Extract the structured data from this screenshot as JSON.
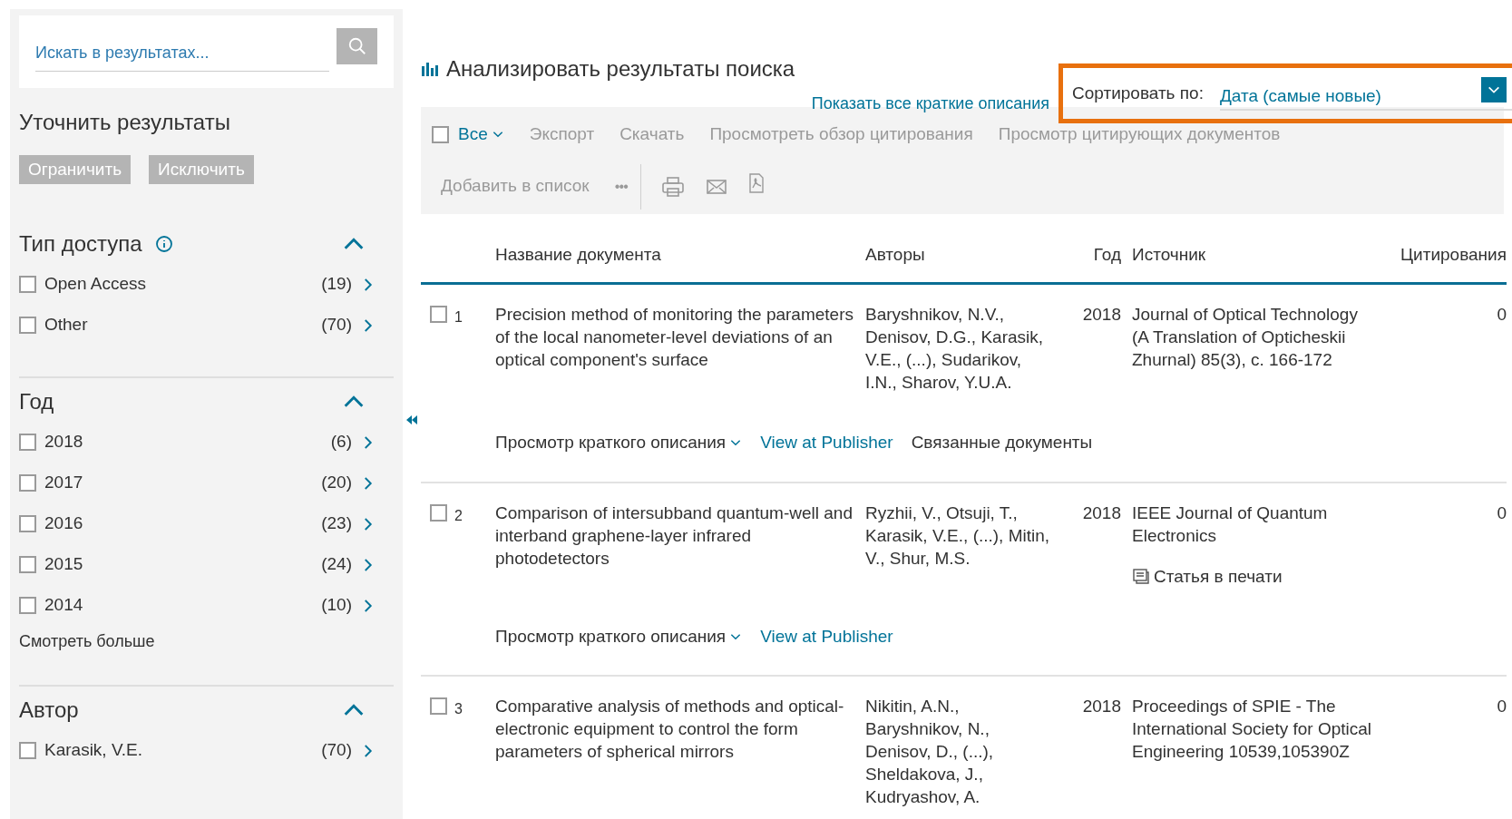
{
  "sidebar": {
    "search": {
      "placeholder": "Искать в результатах..."
    },
    "refine_title": "Уточнить результаты",
    "buttons": [
      "Ограничить",
      "Исключить"
    ],
    "sections": [
      {
        "title": "Тип доступа",
        "info": true,
        "expanded": true,
        "items": [
          {
            "label": "Open Access",
            "count": "(19)",
            "checked": false
          },
          {
            "label": "Other",
            "count": "(70)",
            "checked": false
          }
        ]
      },
      {
        "title": "Год",
        "info": false,
        "expanded": true,
        "more": "Смотреть больше",
        "items": [
          {
            "label": "2018",
            "count": "(6)",
            "checked": false
          },
          {
            "label": "2017",
            "count": "(20)",
            "checked": false
          },
          {
            "label": "2016",
            "count": "(23)",
            "checked": false
          },
          {
            "label": "2015",
            "count": "(24)",
            "checked": false
          },
          {
            "label": "2014",
            "count": "(10)",
            "checked": false
          }
        ]
      },
      {
        "title": "Автор",
        "info": false,
        "expanded": true,
        "items": [
          {
            "label": "Karasik, V.E.",
            "count": "(70)",
            "checked": false
          }
        ]
      }
    ]
  },
  "main": {
    "title": "Анализировать результаты поиска",
    "show_all_link": "Показать все краткие описания",
    "sort": {
      "label": "Сортировать по:",
      "value": "Дата (самые новые)"
    },
    "toolbar": {
      "select_all": {
        "label": "Все",
        "checked": false
      },
      "actions": [
        "Экспорт",
        "Скачать",
        "Просмотреть обзор цитирования",
        "Просмотр цитирующих документов"
      ],
      "add_to_list": "Добавить в список",
      "more": "•••"
    },
    "table": {
      "columns": [
        "Название документа",
        "Авторы",
        "Год",
        "Источник",
        "Цитирования"
      ],
      "rows": [
        {
          "number": "1",
          "checked": false,
          "title": "Precision method of monitoring the parameters of the local nanometer-level deviations of an optical component's surface",
          "authors": "Baryshnikov, N.V., Denisov, D.G., Karasik, V.E., (...), Sudarikov, I.N., Sharov, Y.U.A.",
          "year": "2018",
          "source": "Journal of Optical Technology (A Translation of Opticheskii Zhurnal) 85(3), с. 166-172",
          "citations": "0",
          "in_press": null,
          "links": [
            {
              "kind": "dropdown",
              "label": "Просмотр краткого описания"
            },
            {
              "kind": "link",
              "label": "View at Publisher"
            },
            {
              "kind": "plain",
              "label": "Связанные документы"
            }
          ]
        },
        {
          "number": "2",
          "checked": false,
          "title": "Comparison of intersubband quantum-well and interband graphene-layer infrared photodetectors",
          "authors": "Ryzhii, V., Otsuji, T., Karasik, V.E., (...), Mitin, V., Shur, M.S.",
          "year": "2018",
          "source": "IEEE Journal of Quantum Electronics",
          "citations": "0",
          "in_press": "Статья в печати",
          "links": [
            {
              "kind": "dropdown",
              "label": "Просмотр краткого описания"
            },
            {
              "kind": "link",
              "label": "View at Publisher"
            }
          ]
        },
        {
          "number": "3",
          "checked": false,
          "title": "Comparative analysis of methods and optical-electronic equipment to control the form parameters of spherical mirrors",
          "authors": "Nikitin, A.N., Baryshnikov, N., Denisov, D., (...), Sheldakova, J., Kudryashov, A.",
          "year": "2018",
          "source": "Proceedings of SPIE - The International Society for Optical Engineering 10539,105390Z",
          "citations": "0",
          "in_press": null,
          "links": []
        }
      ]
    }
  }
}
